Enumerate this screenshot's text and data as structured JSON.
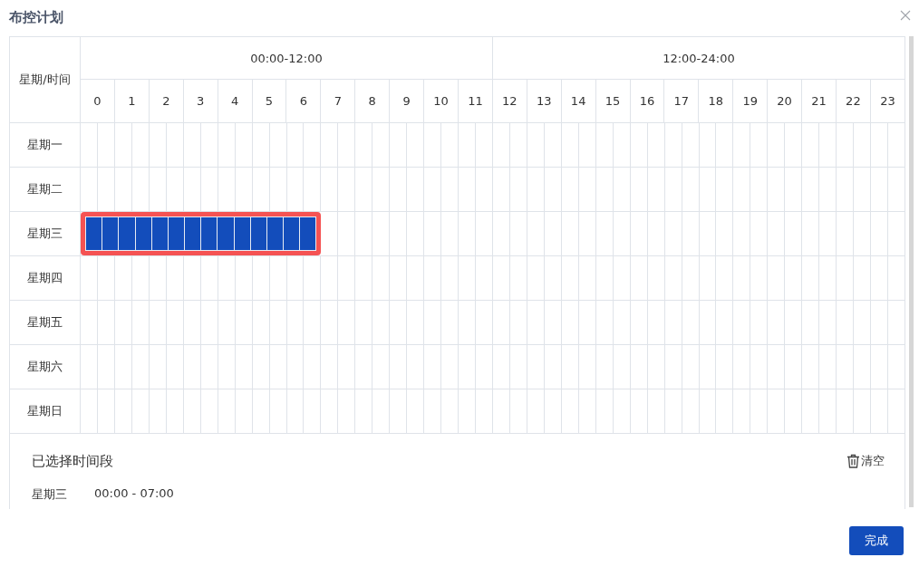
{
  "dialog": {
    "title": "布控计划"
  },
  "schedule": {
    "corner_label": "星期/时间",
    "periods": [
      "00:00-12:00",
      "12:00-24:00"
    ],
    "hours": [
      "0",
      "1",
      "2",
      "3",
      "4",
      "5",
      "6",
      "7",
      "8",
      "9",
      "10",
      "11",
      "12",
      "13",
      "14",
      "15",
      "16",
      "17",
      "18",
      "19",
      "20",
      "21",
      "22",
      "23"
    ],
    "days": [
      {
        "label": "星期一",
        "slots": [
          false,
          false,
          false,
          false,
          false,
          false,
          false,
          false,
          false,
          false,
          false,
          false,
          false,
          false,
          false,
          false,
          false,
          false,
          false,
          false,
          false,
          false,
          false,
          false,
          false,
          false,
          false,
          false,
          false,
          false,
          false,
          false,
          false,
          false,
          false,
          false,
          false,
          false,
          false,
          false,
          false,
          false,
          false,
          false,
          false,
          false,
          false,
          false
        ]
      },
      {
        "label": "星期二",
        "slots": [
          false,
          false,
          false,
          false,
          false,
          false,
          false,
          false,
          false,
          false,
          false,
          false,
          false,
          false,
          false,
          false,
          false,
          false,
          false,
          false,
          false,
          false,
          false,
          false,
          false,
          false,
          false,
          false,
          false,
          false,
          false,
          false,
          false,
          false,
          false,
          false,
          false,
          false,
          false,
          false,
          false,
          false,
          false,
          false,
          false,
          false,
          false,
          false
        ]
      },
      {
        "label": "星期三",
        "slots": [
          true,
          true,
          true,
          true,
          true,
          true,
          true,
          true,
          true,
          true,
          true,
          true,
          true,
          true,
          false,
          false,
          false,
          false,
          false,
          false,
          false,
          false,
          false,
          false,
          false,
          false,
          false,
          false,
          false,
          false,
          false,
          false,
          false,
          false,
          false,
          false,
          false,
          false,
          false,
          false,
          false,
          false,
          false,
          false,
          false,
          false,
          false,
          false
        ]
      },
      {
        "label": "星期四",
        "slots": [
          false,
          false,
          false,
          false,
          false,
          false,
          false,
          false,
          false,
          false,
          false,
          false,
          false,
          false,
          false,
          false,
          false,
          false,
          false,
          false,
          false,
          false,
          false,
          false,
          false,
          false,
          false,
          false,
          false,
          false,
          false,
          false,
          false,
          false,
          false,
          false,
          false,
          false,
          false,
          false,
          false,
          false,
          false,
          false,
          false,
          false,
          false,
          false
        ]
      },
      {
        "label": "星期五",
        "slots": [
          false,
          false,
          false,
          false,
          false,
          false,
          false,
          false,
          false,
          false,
          false,
          false,
          false,
          false,
          false,
          false,
          false,
          false,
          false,
          false,
          false,
          false,
          false,
          false,
          false,
          false,
          false,
          false,
          false,
          false,
          false,
          false,
          false,
          false,
          false,
          false,
          false,
          false,
          false,
          false,
          false,
          false,
          false,
          false,
          false,
          false,
          false,
          false
        ]
      },
      {
        "label": "星期六",
        "slots": [
          false,
          false,
          false,
          false,
          false,
          false,
          false,
          false,
          false,
          false,
          false,
          false,
          false,
          false,
          false,
          false,
          false,
          false,
          false,
          false,
          false,
          false,
          false,
          false,
          false,
          false,
          false,
          false,
          false,
          false,
          false,
          false,
          false,
          false,
          false,
          false,
          false,
          false,
          false,
          false,
          false,
          false,
          false,
          false,
          false,
          false,
          false,
          false
        ]
      },
      {
        "label": "星期日",
        "slots": [
          false,
          false,
          false,
          false,
          false,
          false,
          false,
          false,
          false,
          false,
          false,
          false,
          false,
          false,
          false,
          false,
          false,
          false,
          false,
          false,
          false,
          false,
          false,
          false,
          false,
          false,
          false,
          false,
          false,
          false,
          false,
          false,
          false,
          false,
          false,
          false,
          false,
          false,
          false,
          false,
          false,
          false,
          false,
          false,
          false,
          false,
          false,
          false
        ]
      }
    ]
  },
  "selected_panel": {
    "title": "已选择时间段",
    "clear_label": "清空",
    "entries": [
      {
        "day": "星期三",
        "range": "00:00 - 07:00"
      }
    ]
  },
  "buttons": [
    {
      "label": "完成"
    }
  ]
}
